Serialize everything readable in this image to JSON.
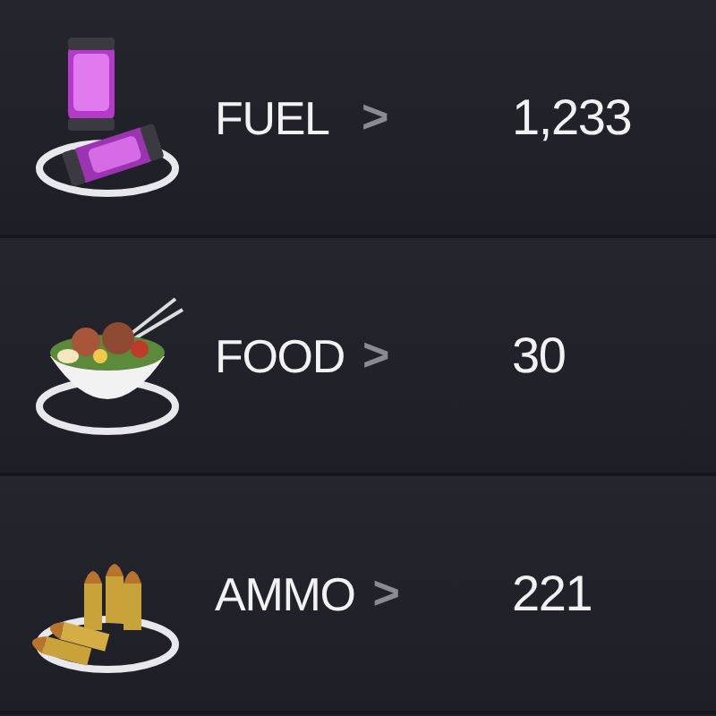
{
  "resources": [
    {
      "kind": "fuel",
      "label": "FUEL",
      "chevron": ">",
      "value": "1,233"
    },
    {
      "kind": "food",
      "label": "FOOD",
      "chevron": ">",
      "value": "30"
    },
    {
      "kind": "ammo",
      "label": "AMMO",
      "chevron": ">",
      "value": "221"
    }
  ]
}
